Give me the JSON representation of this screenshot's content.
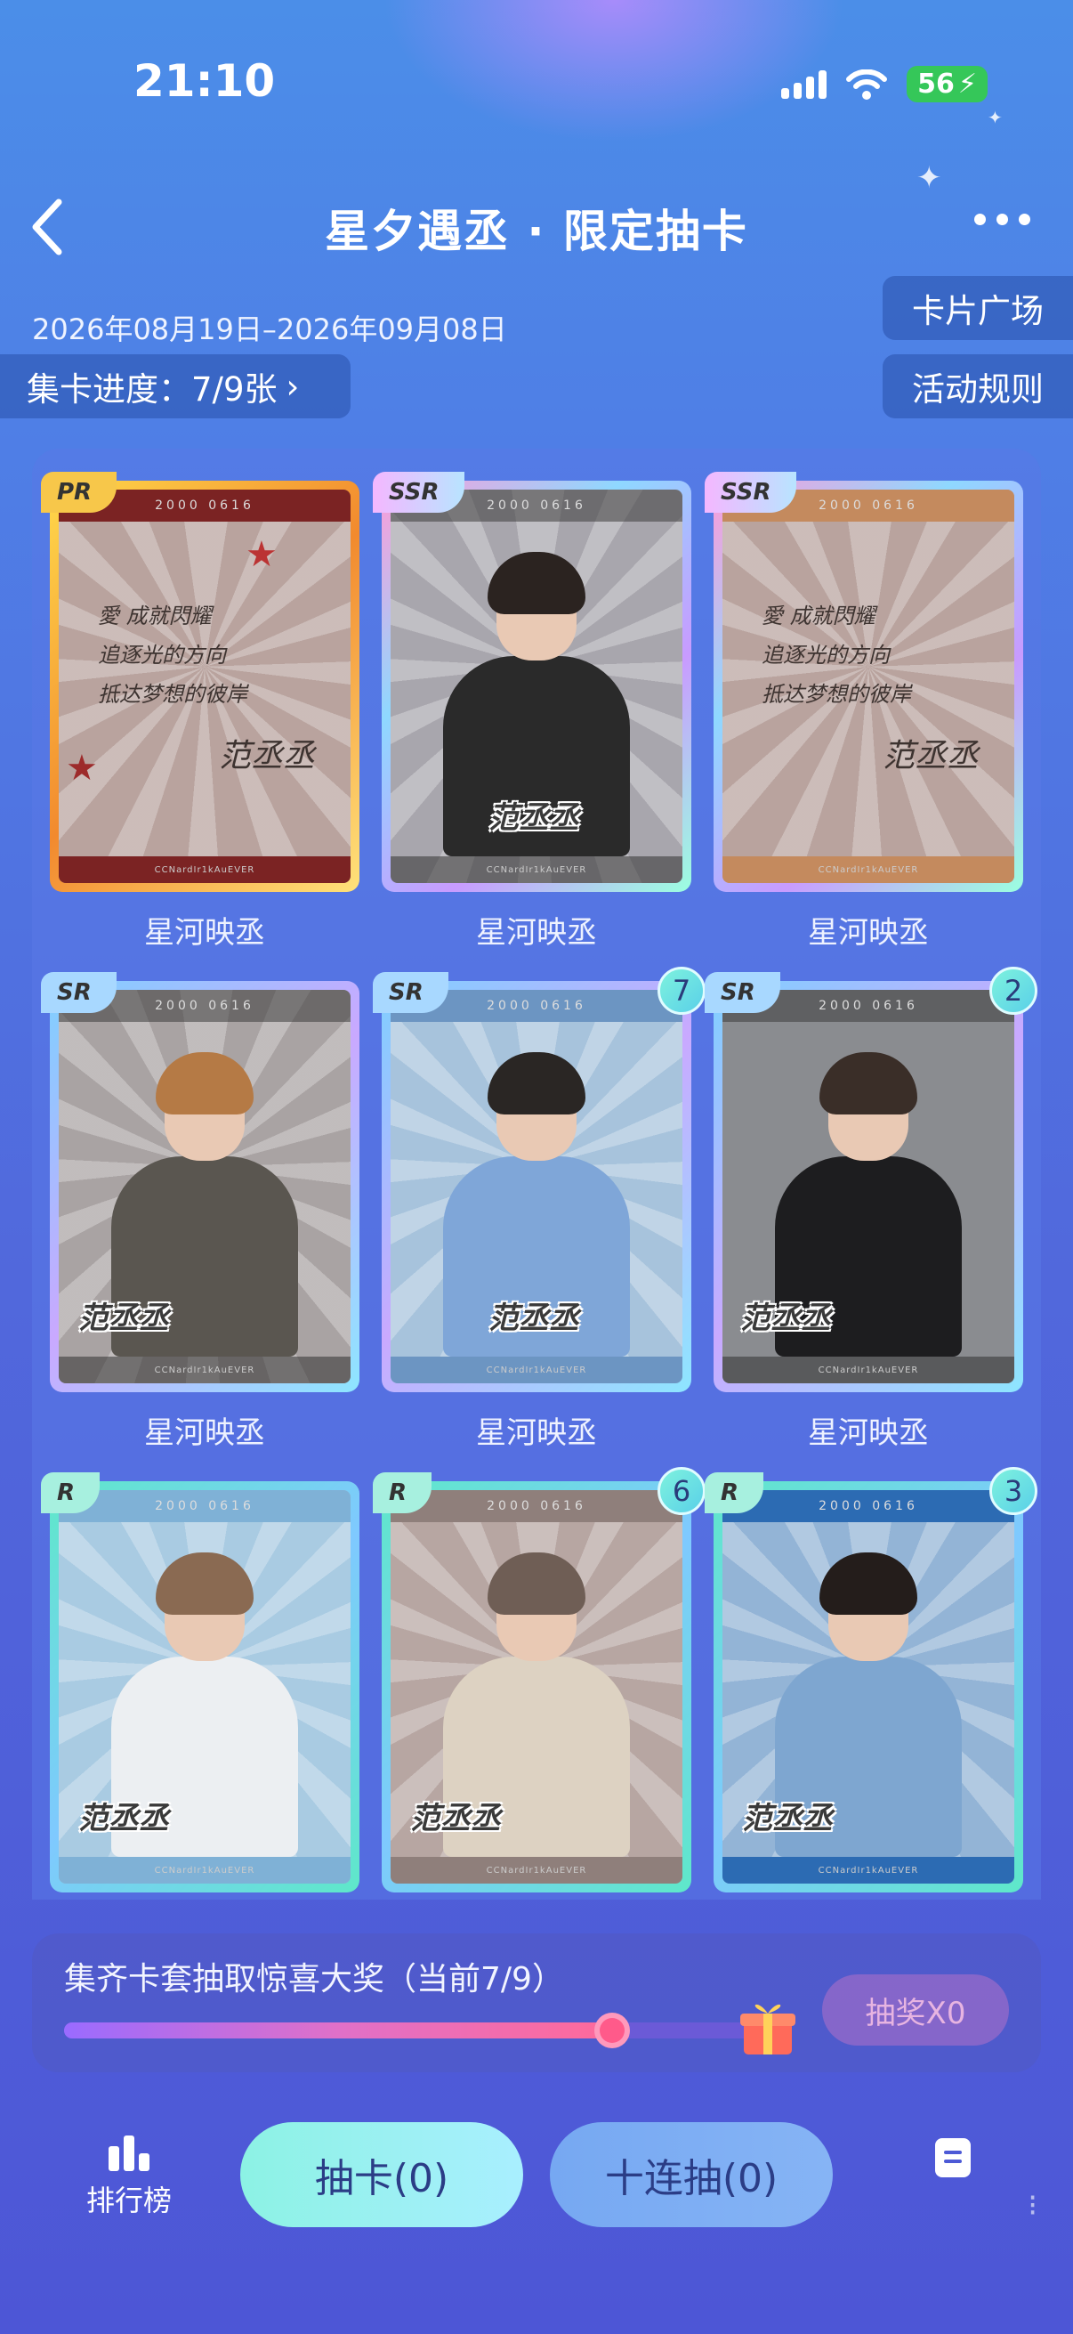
{
  "status_bar": {
    "time": "21:10",
    "battery": "56"
  },
  "header": {
    "title": "星夕遇丞 · 限定抽卡"
  },
  "info": {
    "date_range": "2026年08月19日–2026年09月08日",
    "progress_label": "集卡进度：7/9张",
    "card_square": "卡片广场",
    "rules": "活动规则"
  },
  "cards": [
    {
      "rarity": "PR",
      "label": "星河映丞",
      "count": "",
      "stamp": "",
      "top_text": "2000 0616",
      "bottom_text": "CCNardIr1kAuEVER",
      "note_lines": [
        "愛 成就閃耀",
        "追逐光的方向",
        "抵达梦想的彼岸"
      ],
      "signature": "范丞丞"
    },
    {
      "rarity": "SSR",
      "label": "星河映丞",
      "count": "",
      "stamp": "范丞丞",
      "top_text": "2000 0616",
      "bottom_text": "CCNardIr1kAuEVER"
    },
    {
      "rarity": "SSR",
      "label": "星河映丞",
      "count": "",
      "stamp": "",
      "top_text": "2000 0616",
      "bottom_text": "CCNardIr1kAuEVER",
      "note_lines": [
        "愛 成就閃耀",
        "追逐光的方向",
        "抵达梦想的彼岸"
      ],
      "signature": "范丞丞"
    },
    {
      "rarity": "SR",
      "label": "星河映丞",
      "count": "",
      "stamp": "范丞丞",
      "top_text": "2000 0616",
      "bottom_text": "CCNardIr1kAuEVER"
    },
    {
      "rarity": "SR",
      "label": "星河映丞",
      "count": "7",
      "stamp": "范丞丞",
      "top_text": "2000 0616",
      "bottom_text": "CCNardIr1kAuEVER"
    },
    {
      "rarity": "SR",
      "label": "星河映丞",
      "count": "2",
      "stamp": "范丞丞",
      "top_text": "2000 0616",
      "bottom_text": "CCNardIr1kAuEVER"
    },
    {
      "rarity": "R",
      "label": "",
      "count": "",
      "stamp": "范丞丞",
      "top_text": "2000 0616",
      "bottom_text": "CCNardIr1kAuEVER"
    },
    {
      "rarity": "R",
      "label": "",
      "count": "6",
      "stamp": "范丞丞",
      "top_text": "2000 0616",
      "bottom_text": "CCNardIr1kAuEVER"
    },
    {
      "rarity": "R",
      "label": "",
      "count": "3",
      "stamp": "范丞丞",
      "top_text": "2000 0616",
      "bottom_text": "CCNardIr1kAuEVER"
    }
  ],
  "reward": {
    "text": "集齐卡套抽取惊喜大奖（当前7/9）",
    "progress": 0.78,
    "lottery_button": "抽奖X0"
  },
  "bottom_bar": {
    "rank_label": "排行榜",
    "draw_button": "抽卡(0)",
    "ten_draw_button": "十连抽(0)",
    "side_mark": "⁝"
  },
  "colors": {
    "pr_frame": "#f7c74a",
    "ssr_frame": "#c89bff",
    "sr_frame": "#7fd0ff",
    "r_frame": "#5ee8c9"
  }
}
